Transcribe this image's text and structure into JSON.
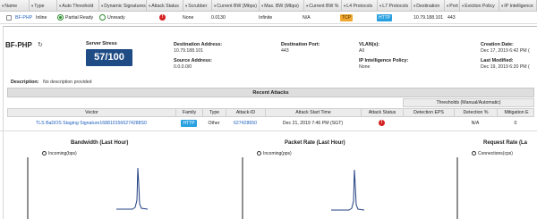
{
  "columns": [
    "Name",
    "Type",
    "Auto Threshold",
    "Dynamic Signatures",
    "Attack Status",
    "Scrubber",
    "Current BW (Mbps)",
    "Max. BW (Mbps)",
    "Current BW %",
    "L4 Protocols",
    "L7 Protocols",
    "Destination",
    "Port",
    "Eviction Policy",
    "IP Intelligence"
  ],
  "row": {
    "name": "BF-PHP",
    "type": "Inline",
    "auto_threshold": "Partial Ready",
    "dynamic_signatures": "Unready",
    "attack_status_icon": "alert-icon",
    "scrubber": "None",
    "current_bw": "0.0130",
    "max_bw": "Infinite",
    "current_bw_pct": "N/A",
    "l4_protocol": "TCP",
    "l7_protocol": "HTTP",
    "destination": "10.79.188.101",
    "port": "443"
  },
  "detail": {
    "name": "BF-PHP",
    "server_stress_label": "Server Stress",
    "server_stress_value": "57/100",
    "dest_address_label": "Destination Address:",
    "dest_address": "10.79.188.101",
    "dest_port_label": "Destination Port:",
    "dest_port": "443",
    "vlans_label": "VLAN(s):",
    "vlans": "All",
    "creation_label": "Creation Date:",
    "creation_date": "Dec 17, 2019 6:42 PM (",
    "source_address_label": "Source Address:",
    "source_address": "0.0.0.0/0",
    "ip_intel_label": "IP Intelligence Policy:",
    "ip_intel": "None",
    "last_modified_label": "Last Modified:",
    "last_modified": "Dec 19, 2019 6:20 PM (",
    "description_label": "Description:",
    "description": "No description provided"
  },
  "recent_attacks": {
    "title": "Recent Attacks",
    "thresholds_title": "Thresholds (Manual/Automatic)",
    "headers": [
      "Vector",
      "Family",
      "Type",
      "Attack-ID",
      "Attack Start Time",
      "Attack Status",
      "Detection EPS",
      "Detection %",
      "Mitigation E"
    ],
    "rows": [
      {
        "vector": "TLS BaDOS Staging Signature1688101566274288S0",
        "family": "HTTP",
        "type": "Other",
        "attack_id": "627428650",
        "start_time": "Dec 21, 2019 7:46 PM (SGT)",
        "detection_eps": "",
        "detection_pct": "N/A",
        "mitigation": "0"
      }
    ]
  },
  "graphs": [
    {
      "title": "Bandwidth (Last Hour)",
      "legend": "Incoming(bps)"
    },
    {
      "title": "Packet Rate (Last Hour)",
      "legend": "Incoming(pps)"
    },
    {
      "title": "Request Rate (La",
      "legend": "Connections(cps)"
    }
  ],
  "colors": {
    "accent": "#1f4c85",
    "link": "#1e5fc0",
    "tcp": "#f0a830",
    "http": "#29a0e0",
    "alert": "#d42020"
  }
}
